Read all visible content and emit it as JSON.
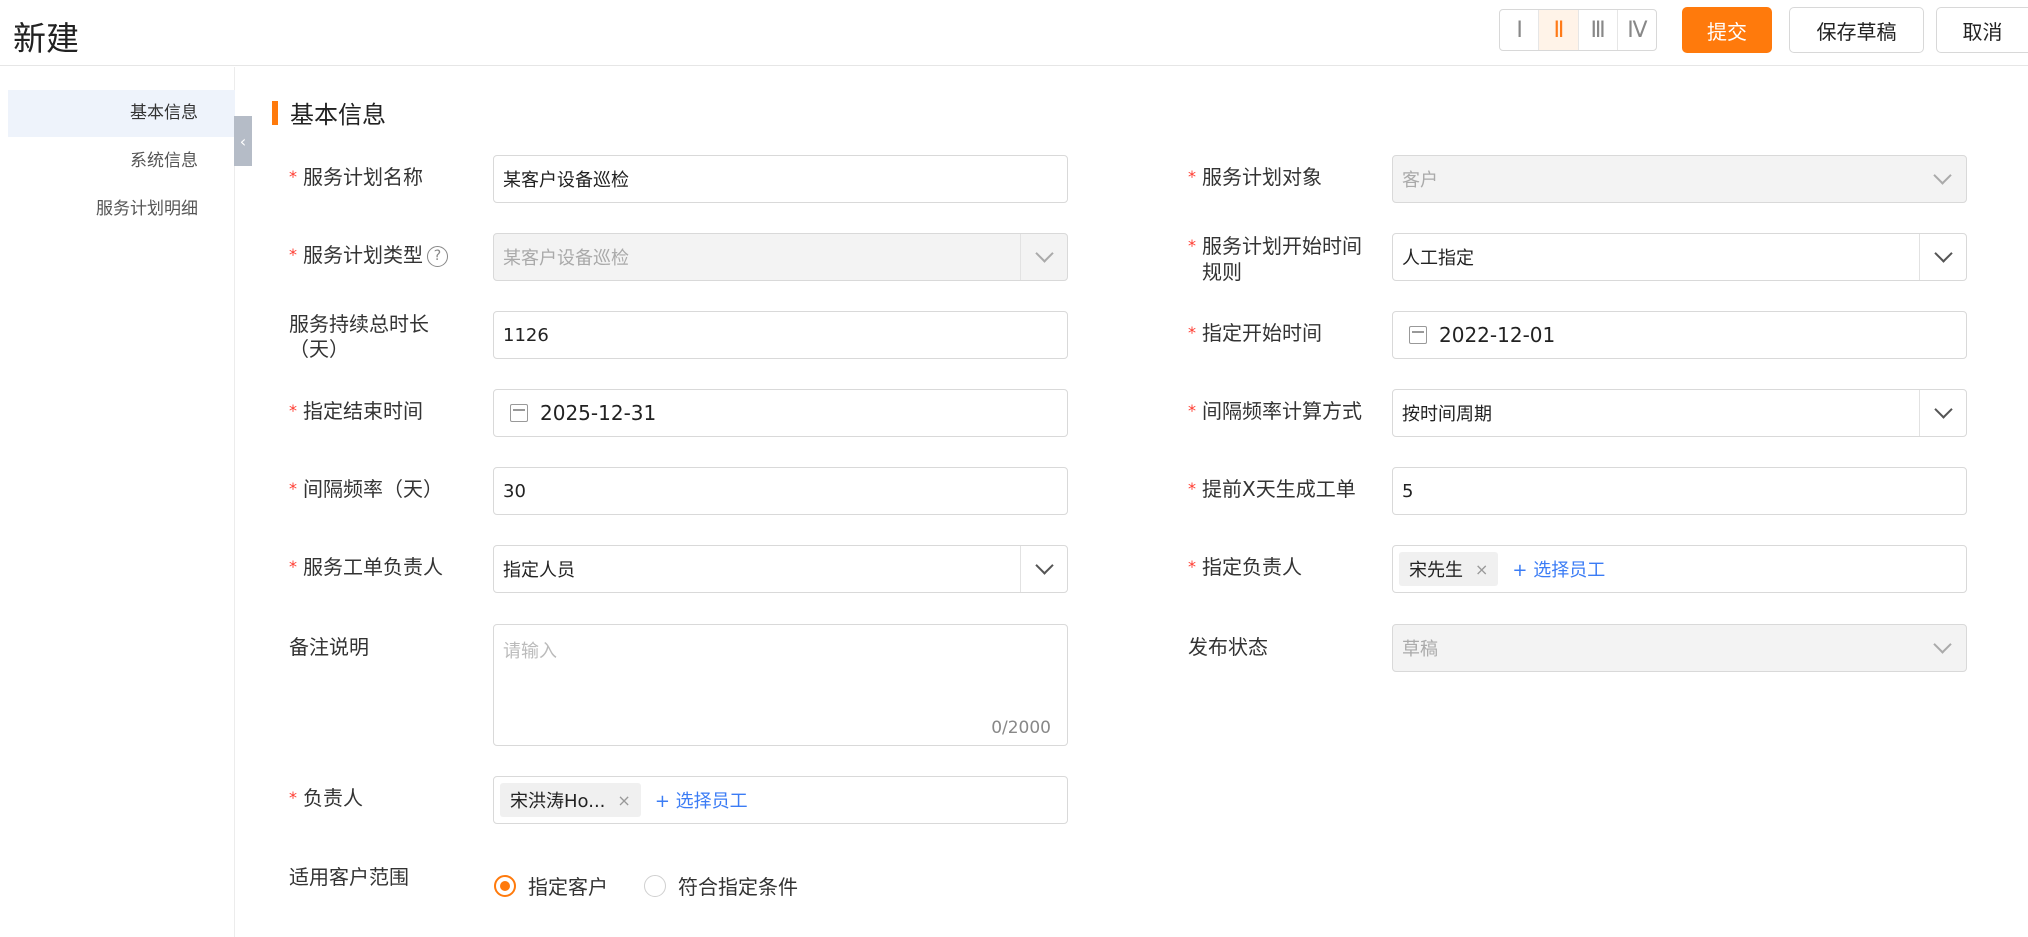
{
  "header": {
    "title": "新建",
    "layout_options": [
      "Ⅰ",
      "Ⅱ",
      "Ⅲ",
      "Ⅳ"
    ],
    "layout_active_index": 1,
    "submit_label": "提交",
    "save_draft_label": "保存草稿",
    "cancel_label": "取消"
  },
  "sidebar": {
    "items": [
      {
        "label": "基本信息",
        "active": true
      },
      {
        "label": "系统信息",
        "active": false
      },
      {
        "label": "服务计划明细",
        "active": false
      }
    ],
    "collapse_icon": "chevron-left-icon"
  },
  "section": {
    "title": "基本信息"
  },
  "form": {
    "plan_name": {
      "label": "服务计划名称",
      "value": "某客户设备巡检"
    },
    "plan_target": {
      "label": "服务计划对象",
      "value": "客户"
    },
    "plan_type": {
      "label": "服务计划类型",
      "value": "某客户设备巡检",
      "help": "?"
    },
    "start_rule": {
      "label_line1": "服务计划开始时间",
      "label_line2": "规则",
      "value": "人工指定"
    },
    "duration": {
      "label_line1": "服务持续总时长",
      "label_line2": "（天）",
      "value": "1126"
    },
    "start_time": {
      "label": "指定开始时间",
      "value": "2022-12-01"
    },
    "end_time": {
      "label": "指定结束时间",
      "value": "2025-12-31"
    },
    "interval_method": {
      "label": "间隔频率计算方式",
      "value": "按时间周期"
    },
    "interval_days": {
      "label": "间隔频率（天）",
      "value": "30"
    },
    "advance_days": {
      "label": "提前X天生成工单",
      "value": "5"
    },
    "order_owner": {
      "label": "服务工单负责人",
      "value": "指定人员"
    },
    "assigned_owner": {
      "label": "指定负责人",
      "tag": "宋先生",
      "add_label": "+ 选择员工"
    },
    "remark": {
      "label": "备注说明",
      "placeholder": "请输入",
      "counter": "0/2000"
    },
    "publish_status": {
      "label": "发布状态",
      "value": "草稿"
    },
    "owner": {
      "label": "负责人",
      "tag": "宋洪涛Ho...",
      "add_label": "+ 选择员工"
    },
    "customer_scope": {
      "label": "适用客户范围",
      "options": [
        "指定客户",
        "符合指定条件"
      ],
      "selected_index": 0
    }
  },
  "colors": {
    "accent": "#ff7a0c",
    "link": "#3b7cf5",
    "required": "#ff3b30"
  }
}
